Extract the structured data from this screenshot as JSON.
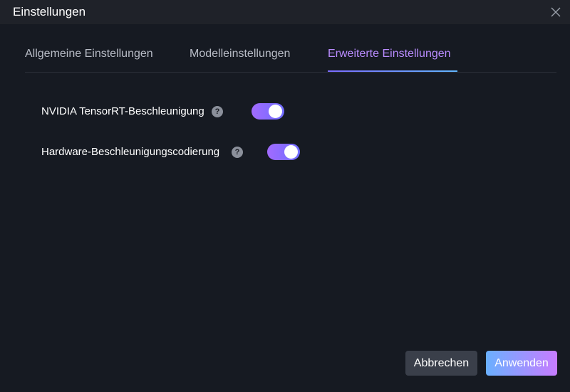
{
  "window": {
    "title": "Einstellungen",
    "close_icon": "close-icon"
  },
  "tabs": [
    {
      "label": "Allgemeine Einstellungen",
      "active": false
    },
    {
      "label": "Modelleinstellungen",
      "active": false
    },
    {
      "label": "Erweiterte Einstellungen",
      "active": true
    }
  ],
  "settings": [
    {
      "label": "NVIDIA TensorRT-Beschleunigung",
      "help": "?",
      "enabled": true
    },
    {
      "label": "Hardware-Beschleunigungscodierung",
      "help": "?",
      "enabled": true
    }
  ],
  "buttons": {
    "cancel_label": "Abbrechen",
    "apply_label": "Anwenden"
  },
  "colors": {
    "accent": "#b98cff",
    "background": "#161a22",
    "titlebar": "#1f2229",
    "toggle_on": "#8f6cff",
    "cancel_button": "#3a3f4a"
  }
}
